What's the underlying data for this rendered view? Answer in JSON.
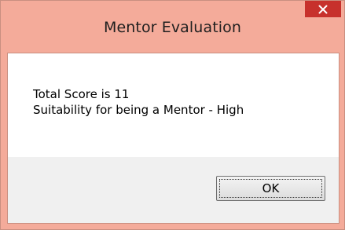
{
  "dialog": {
    "title": "Mentor Evaluation",
    "close_icon": "close-icon",
    "message_lines": [
      "Total Score is 11",
      "Suitability for being a Mentor - High"
    ],
    "ok_label": "OK"
  },
  "colors": {
    "frame": "#f4ab9a",
    "close_button": "#c7312c",
    "client_background": "#ffffff",
    "footer_background": "#f0f0f0"
  }
}
